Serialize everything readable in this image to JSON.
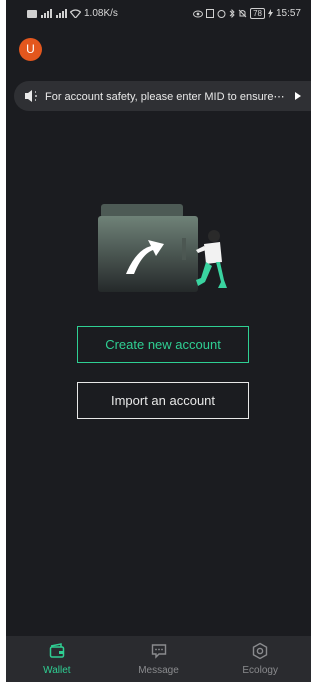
{
  "status_bar": {
    "left_text": "1.08K/s",
    "battery": "78",
    "time": "15:57"
  },
  "avatar": {
    "letter": "U"
  },
  "notice": {
    "text": "For account safety, please enter MID to ensure⋯"
  },
  "buttons": {
    "create": "Create new account",
    "import": "Import an account"
  },
  "nav": [
    {
      "label": "Wallet",
      "icon": "wallet-icon",
      "active": true
    },
    {
      "label": "Message",
      "icon": "message-icon",
      "active": false
    },
    {
      "label": "Ecology",
      "icon": "ecology-icon",
      "active": false
    }
  ],
  "colors": {
    "accent": "#2fcf93",
    "background": "#1b1c20",
    "avatar": "#e3571e",
    "notice_bg": "#2f3034",
    "navbar_bg": "#2a2b2f"
  }
}
